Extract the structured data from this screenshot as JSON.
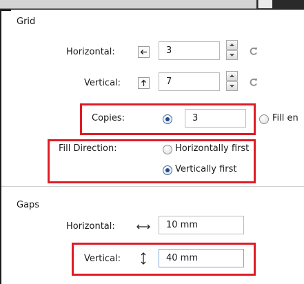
{
  "grid": {
    "section_title": "Grid",
    "horizontal_label": "Horizontal:",
    "horizontal_value": "3",
    "vertical_label": "Vertical:",
    "vertical_value": "7",
    "copies_label": "Copies:",
    "copies_value": "3",
    "fill_entire_label": "Fill en",
    "fill_direction_label": "Fill Direction:",
    "fill_options": [
      "Horizontally first",
      "Vertically first"
    ],
    "fill_selected": "Vertically first"
  },
  "gaps": {
    "section_title": "Gaps",
    "horizontal_label": "Horizontal:",
    "horizontal_value": "10 mm",
    "vertical_label": "Vertical:",
    "vertical_value": "40 mm"
  },
  "colors": {
    "highlight": "#e01b24",
    "radio_selected": "#244a8a",
    "icon_gray": "#888888"
  },
  "icons": {
    "horizontal_arrow": "arrow-left-icon",
    "vertical_arrow": "arrow-up-icon",
    "reset": "reset-icon",
    "gap_horizontal": "double-arrow-horizontal-icon",
    "gap_vertical": "double-arrow-vertical-icon"
  }
}
